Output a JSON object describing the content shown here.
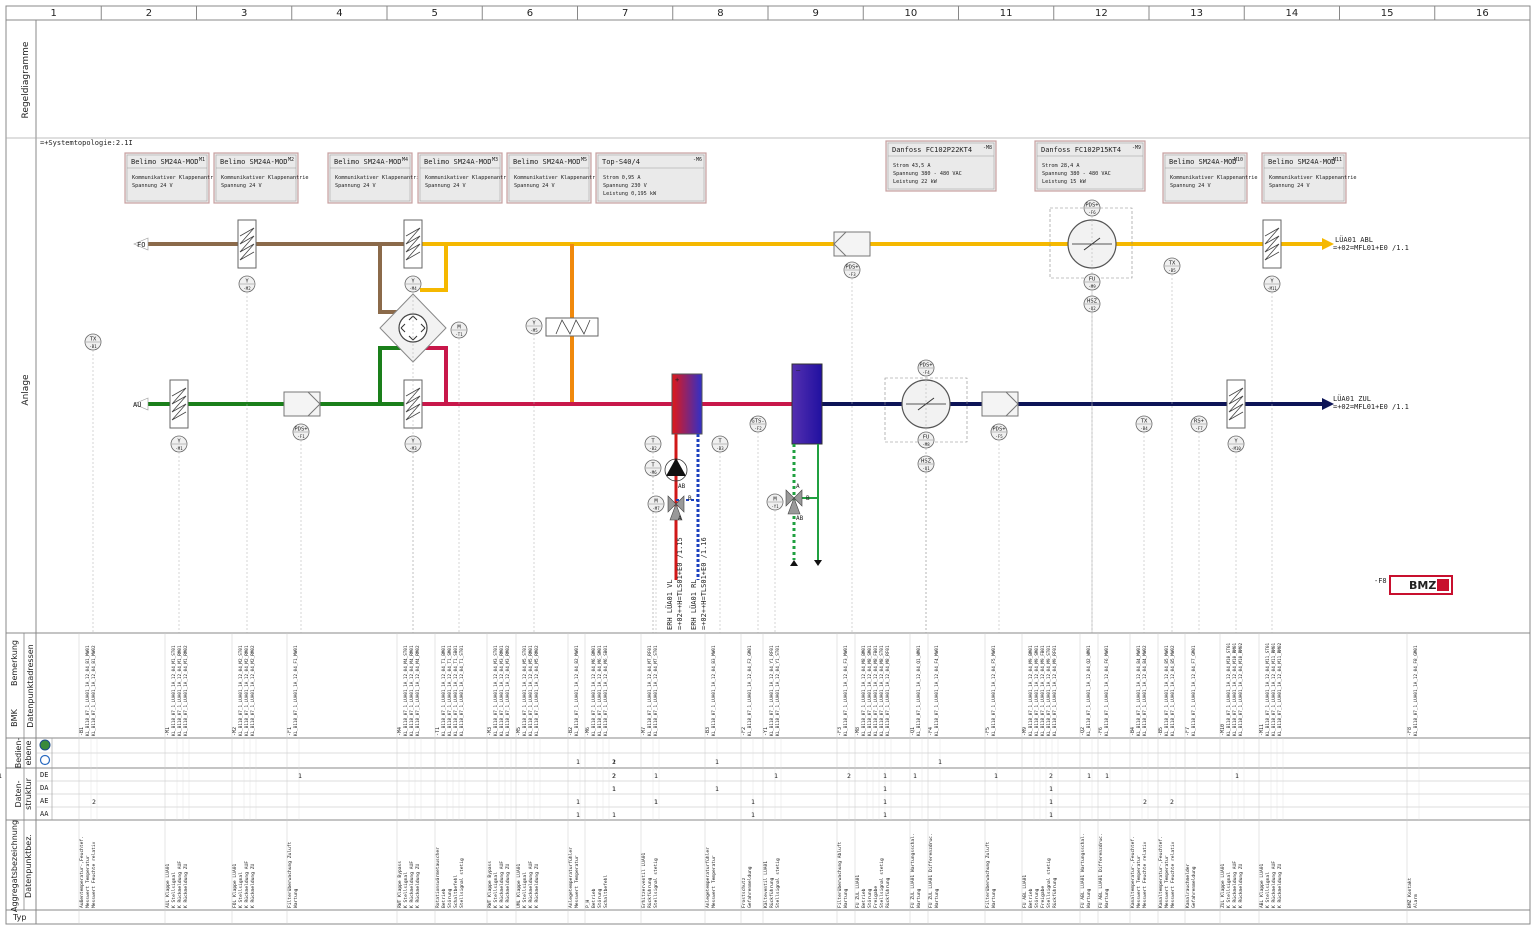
{
  "columns": [
    "1",
    "2",
    "3",
    "4",
    "5",
    "6",
    "7",
    "8",
    "9",
    "10",
    "11",
    "12",
    "13",
    "14",
    "15",
    "16"
  ],
  "row_labels": {
    "regel": "Regeldiagramme",
    "anlage": "Anlage",
    "bmk_a": "BMK",
    "bmk_b": "Datenpunktadressen",
    "bem_a": "Bemerkung",
    "bed_a": "Bedien-",
    "bed_b": "ebene",
    "dat_a": "Daten-",
    "dat_b": "struktur",
    "agg_a": "Aggregatsbezeichnung",
    "agg_b": "Datenpunktbez.",
    "typ": "Typ",
    "de": "DE",
    "da": "DA",
    "ae": "AE",
    "aa": "AA"
  },
  "topology": "=+Systemtopologie:2.1I",
  "devices": [
    {
      "name": "Belimo SM24A-MOD",
      "tag": "-M1",
      "line1": "Kommunikativer Klappenantrie",
      "line2": "Spannung    24 V"
    },
    {
      "name": "Belimo SM24A-MOD",
      "tag": "-M2",
      "line1": "Kommunikativer Klappenantrie",
      "line2": "Spannung    24 V"
    },
    {
      "name": "Belimo SM24A-MOD",
      "tag": "-M4",
      "line1": "Kommunikativer Klappenantrie",
      "line2": "Spannung    24 V"
    },
    {
      "name": "Belimo SM24A-MOD",
      "tag": "-M3",
      "line1": "Kommunikativer Klappenantrie",
      "line2": "Spannung    24 V"
    },
    {
      "name": "Belimo SM24A-MOD",
      "tag": "-M5",
      "line1": "Kommunikativer Klappenantrie",
      "line2": "Spannung    24 V"
    },
    {
      "name": "Top-S40/4",
      "tag": "-M6",
      "line1": "Strom    0,95 A",
      "line2": "Spannung  230 V",
      "line3": "Leistung  0,195 kW"
    },
    {
      "name": "Danfoss FC102P22KT4",
      "tag": "-M8",
      "line1": "Strom    43,5 A",
      "line2": "Spannung  380 - 480 VAC",
      "line3": "Leistung  22 kW"
    },
    {
      "name": "Danfoss FC102P15KT4",
      "tag": "-M9",
      "line1": "Strom    28,4 A",
      "line2": "Spannung  380 - 480 VAC",
      "line3": "Leistung  15 kW"
    },
    {
      "name": "Belimo SM24A-MOD",
      "tag": "-M10",
      "line1": "Kommunikativer Klappenantrie",
      "line2": "Spannung    24 V"
    },
    {
      "name": "Belimo SM24A-MOD",
      "tag": "-M11",
      "line1": "Kommunikativer Klappenantrie",
      "line2": "Spannung    24 V"
    }
  ],
  "labels": {
    "fo": "FO",
    "au": "AU",
    "abl": "LÜA01 ABL",
    "abl_ref": "=+02=MFL01+E0 /1.1",
    "zul": "LÜA01 ZUL",
    "zul_ref": "=+02=MFL01+E0 /1.1",
    "vl": "ERH LÜA01 VL",
    "vl_ref": "=+02++H=TLS01+E0 /1.15",
    "rl": "ERH LÜA01 RL",
    "rl_ref": "=+02++H=TLS01+E0 /1.16",
    "bmz": "BMZ",
    "bmz_tag": "-F8"
  },
  "sensors": {
    "y": "Y",
    "m": "M",
    "tx": "TX",
    "t": "T",
    "pds": "PDS+",
    "fu": "FU",
    "hsz": "HSZ",
    "rs": "RS+",
    "gts": "GTS-",
    "m1": "-M1",
    "m2": "-M2",
    "m3": "-M3",
    "m4": "-M4",
    "m5": "-M5",
    "m7": "-M7",
    "m9": "-M9",
    "m10": "-M10",
    "m11": "-M11",
    "b1": "-B1",
    "b2": "-B2",
    "b3": "-B3",
    "b4": "-B4",
    "b5": "-B5",
    "f1": "-F1",
    "f2": "-F2",
    "f3": "-F3",
    "f4": "-F4",
    "f5": "-F5",
    "f6": "-F6",
    "f7": "-F7",
    "t1": "-T1",
    "q1": "-Q1",
    "q2": "-Q2",
    "m6": "-M6",
    "m8": "-M8",
    "y1": "-Y1",
    "a": "A",
    "b": "B",
    "ab": "AB"
  },
  "datapoints": [
    {
      "bmk": "-B1",
      "addrs": [
        "KL_B118_07_1_LUA01_1A_12_04_B1_MW01",
        "KL_B118_07_1_LUA01_1A_12_04_B1_MW02"
      ],
      "agg": "Außentemperatur-,Feuchtef.",
      "items": [
        "Messwert Temperatur",
        "Messwert Feuchte relativ"
      ]
    },
    {
      "bmk": "-M1",
      "addrs": [
        "KL_B118_07_1_LUA01_1A_12_04_M1_ST01",
        "KL_B118_07_1_LUA01_1A_12_04_M1_RM01",
        "KL_B118_07_1_LUA01_1A_12_04_M1_RM02"
      ],
      "agg": "AUL Klappe LUA01",
      "items": [
        "K Stellsignal",
        "K Rückmeldung AUF",
        "K Rückmeldung ZU"
      ]
    },
    {
      "bmk": "-M2",
      "addrs": [
        "KL_B118_07_1_LUA01_1A_12_04_M2_ST01",
        "KL_B118_07_1_LUA01_1A_12_04_M2_RM01",
        "KL_B118_07_1_LUA01_1A_12_04_M2_RM02"
      ],
      "agg": "FOL Klappe LUA01",
      "items": [
        "K Stellsignal",
        "K Rückmeldung AUF",
        "K Rückmeldung ZU"
      ]
    },
    {
      "bmk": "-F1",
      "addrs": [
        "KL_B118_07_1_LUA01_1A_12_04_F1_MW01"
      ],
      "agg": "Filterüberwachung Zuluft",
      "items": [
        "Wartung"
      ]
    },
    {
      "bmk": "-M4",
      "addrs": [
        "KL_B118_07_1_LUA01_1A_12_04_M4_ST01",
        "KL_B118_07_1_LUA01_1A_12_04_M4_RM01",
        "KL_B118_07_1_LUA01_1A_12_04_M4_RM02"
      ],
      "agg": "RWT Klappe Bypass",
      "items": [
        "K Stellsignal",
        "K Rückmeldung AUF",
        "K Rückmeldung ZU"
      ]
    },
    {
      "bmk": "-T1",
      "addrs": [
        "KL_B118_07_1_LUA01_1A_12_04_T1_BM01",
        "KL_B118_07_1_LUA01_1A_12_04_T1_SM01",
        "KL_B118_07_1_LUA01_1A_12_04_T1_SB01",
        "KL_B118_07_1_LUA01_1A_12_04_T1_ST01"
      ],
      "agg": "Rotationswärmetauscher",
      "items": [
        "Betrieb",
        "Störung",
        "Schaltbefehl",
        "Stellsignal stetig"
      ]
    },
    {
      "bmk": "-M3",
      "addrs": [
        "KL_B118_07_1_LUA01_1A_12_04_M3_ST01",
        "KL_B118_07_1_LUA01_1A_12_04_M3_RM01",
        "KL_B118_07_1_LUA01_1A_12_04_M3_RM02"
      ],
      "agg": "RWT Klappe Bypass",
      "items": [
        "K Stellsignal",
        "K Rückmeldung AUF",
        "K Rückmeldung ZU"
      ]
    },
    {
      "bmk": "-M5",
      "addrs": [
        "KL_B118_07_1_LUA01_1A_12_04_M5_ST01",
        "KL_B118_07_1_LUA01_1A_12_04_M5_RM01",
        "KL_B118_07_1_LUA01_1A_12_04_M5_RM02"
      ],
      "agg": "UML Klappe LUA01",
      "items": [
        "K Stellsignal",
        "K Rückmeldung AUF",
        "K Rückmeldung ZU"
      ]
    },
    {
      "bmk": "-B2",
      "addrs": [
        "KL_B118_07_1_LUA01_1A_12_04_B2_MW01"
      ],
      "agg": "Anlegetemperaturfühler",
      "items": [
        "Messwert Temperatur"
      ]
    },
    {
      "bmk": "-M6",
      "addrs": [
        "KL_B118_07_1_LUA01_1A_12_04_M6_BM01",
        "KL_B118_07_1_LUA01_1A_12_04_M6_SM01",
        "KL_B118_07_1_LUA01_1A_12_04_M6_SB01"
      ],
      "agg": "P_H",
      "items": [
        "Betrieb",
        "Störung",
        "Schaltbefehl"
      ]
    },
    {
      "bmk": "-M7",
      "addrs": [
        "KL_B118_07_1_LUA01_1A_12_04_M7_RF01",
        "KL_B118_07_1_LUA01_1A_12_04_M7_ST01"
      ],
      "agg": "Erhitzerventil LUA01",
      "items": [
        "Rückführung",
        "Stellsignal stetig"
      ]
    },
    {
      "bmk": "-B3",
      "addrs": [
        "KL_B118_07_1_LUA01_1A_12_04_B3_MW01"
      ],
      "agg": "Anlegetemperaturfühler",
      "items": [
        "Messwert Temperatur"
      ]
    },
    {
      "bmk": "-F2",
      "addrs": [
        "KL_B118_07_1_LUA01_1A_12_04_F2_GM01"
      ],
      "agg": "Frostschutz",
      "items": [
        "Gefahrenmeldung"
      ]
    },
    {
      "bmk": "-Y1",
      "addrs": [
        "KL_B118_07_1_LUA01_1A_12_04_Y1_RF01",
        "KL_B118_07_1_LUA01_1A_12_04_Y1_ST01"
      ],
      "agg": "Kälteventil LUA01",
      "items": [
        "Rückführung",
        "Stellsignal stetig"
      ]
    },
    {
      "bmk": "-F3",
      "addrs": [
        "KL_B118_07_1_LUA01_1A_12_04_F3_MW01"
      ],
      "agg": "Filterüberwachung Abluft",
      "items": [
        "Wartung"
      ]
    },
    {
      "bmk": "-M8",
      "addrs": [
        "KL_B118_07_1_LUA01_1A_12_04_M8_BM01",
        "KL_B118_07_1_LUA01_1A_12_04_M8_SM01",
        "KL_B118_07_1_LUA01_1A_12_04_M8_FB01",
        "KL_B118_07_1_LUA01_1A_12_04_M8_ST01",
        "KL_B118_07_1_LUA01_1A_12_04_M8_RF01"
      ],
      "agg": "FU ZUL LUA01",
      "items": [
        "Betrieb",
        "Störung",
        "Freigabe",
        "Stellsignal stetig",
        "Rückführung"
      ]
    },
    {
      "bmk": "-Q1",
      "addrs": [
        "KL_B118_07_1_LUA01_1A_12_04_Q1_WM01"
      ],
      "agg": "FU ZUL LUA01 Wartungsschal.",
      "items": [
        "Wartung"
      ]
    },
    {
      "bmk": "-F4",
      "addrs": [
        "KL_B118_07_1_LUA01_1A_12_04_F4_MW01"
      ],
      "agg": "FU ZUL LUA01 Differenzdruc.",
      "items": [
        "Wartung"
      ]
    },
    {
      "bmk": "-F5",
      "addrs": [
        "KL_B118_07_1_LUA01_1A_12_04_F5_MW01"
      ],
      "agg": "Filterüberwachung Zuluft",
      "items": [
        "Wartung"
      ]
    },
    {
      "bmk": "-M9",
      "addrs": [
        "KL_B118_07_1_LUA01_1A_12_04_M9_BM01",
        "KL_B118_07_1_LUA01_1A_12_04_M9_SM01",
        "KL_B118_07_1_LUA01_1A_12_04_M9_FB01",
        "KL_B118_07_1_LUA01_1A_12_04_M9_ST01",
        "KL_B118_07_1_LUA01_1A_12_04_M9_RF01"
      ],
      "agg": "FU ABL LUA01",
      "items": [
        "Betrieb",
        "Störung",
        "Freigabe",
        "Stellsignal stetig",
        "Rückführung"
      ]
    },
    {
      "bmk": "-Q2",
      "addrs": [
        "KL_B118_07_1_LUA01_1A_12_04_Q2_WM01"
      ],
      "agg": "FU ABL LUA01 Wartungsschal.",
      "items": [
        "Wartung"
      ]
    },
    {
      "bmk": "-F6",
      "addrs": [
        "KL_B118_07_1_LUA01_1A_12_04_F6_MW01"
      ],
      "agg": "FU ABL LUA01 Differenzdruc.",
      "items": [
        "Wartung"
      ]
    },
    {
      "bmk": "-B4",
      "addrs": [
        "KL_B118_07_1_LUA01_1A_12_04_B4_MW01",
        "KL_B118_07_1_LUA01_1A_12_04_B4_MW02"
      ],
      "agg": "Kanaltemperatur-,Feuchtef.",
      "items": [
        "Messwert Temperatur",
        "Messwert Feuchte relativ"
      ]
    },
    {
      "bmk": "-B5",
      "addrs": [
        "KL_B118_07_1_LUA01_1A_12_04_B5_MW01",
        "KL_B118_07_1_LUA01_1A_12_04_B5_MW02"
      ],
      "agg": "Kanaltemperatur-,Feuchtef.",
      "items": [
        "Messwert Temperatur",
        "Messwert Feuchte relativ"
      ]
    },
    {
      "bmk": "-F7",
      "addrs": [
        "KL_B118_07_1_LUA01_1A_12_04_F7_GM01"
      ],
      "agg": "Kanalrauchmelder",
      "items": [
        "Gefahrenmeldung"
      ]
    },
    {
      "bmk": "-M10",
      "addrs": [
        "KL_B118_07_1_LUA01_1A_12_04_M10_ST01",
        "KL_B118_07_1_LUA01_1A_12_04_M10_RM01",
        "KL_B118_07_1_LUA01_1A_12_04_M10_RM02"
      ],
      "agg": "ZUL Klappe LUA01",
      "items": [
        "K Stellsignal",
        "K Rückmeldung AUF",
        "K Rückmeldung ZU"
      ]
    },
    {
      "bmk": "-M11",
      "addrs": [
        "KL_B118_07_1_LUA01_1A_12_04_M11_ST01",
        "KL_B118_07_1_LUA01_1A_12_04_M11_RM01",
        "KL_B118_07_1_LUA01_1A_12_04_M11_RM02"
      ],
      "agg": "ABL Klappe LUA01",
      "items": [
        "K Stellsignal",
        "K Rückmeldung AUF",
        "K Rückmeldung ZU"
      ]
    },
    {
      "bmk": "-F8",
      "addrs": [
        "KL_B118_07_1_LUA01_1A_12_04_F8_GM01"
      ],
      "agg": "BMZ Kontakt",
      "items": [
        "Alarm"
      ]
    }
  ],
  "counts": {
    "bed1": [
      {
        "c": "6",
        "v": "2"
      },
      {
        "c": "8",
        "v": "1"
      },
      {
        "c": "9",
        "v": "1"
      },
      {
        "c": "11",
        "v": "1"
      },
      {
        "c": "17",
        "v": "1"
      }
    ],
    "de": [
      {
        "c": "3",
        "v": "1"
      },
      {
        "c": "6",
        "v": "2"
      },
      {
        "c": "8",
        "v": "2"
      },
      {
        "c": "10",
        "v": "1"
      },
      {
        "c": "13",
        "v": "1"
      },
      {
        "c": "14",
        "v": "2"
      },
      {
        "c": "15",
        "v": "1"
      },
      {
        "c": "16",
        "v": "1"
      },
      {
        "c": "18",
        "v": "1"
      },
      {
        "c": "19",
        "v": "2"
      },
      {
        "c": "20",
        "v": "1"
      },
      {
        "c": "21",
        "v": "1"
      },
      {
        "c": "25",
        "v": "1"
      },
      {
        "c": "28",
        "v": "1"
      }
    ],
    "da": [
      {
        "c": "6",
        "v": "1"
      },
      {
        "c": "8",
        "v": "1"
      },
      {
        "c": "11",
        "v": "1"
      },
      {
        "c": "15",
        "v": "1"
      },
      {
        "c": "19",
        "v": "1"
      }
    ],
    "ae": [
      {
        "c": "0",
        "v": "2"
      },
      {
        "c": "7",
        "v": "1"
      },
      {
        "c": "9",
        "v": "1"
      },
      {
        "c": "10",
        "v": "1"
      },
      {
        "c": "12",
        "v": "1"
      },
      {
        "c": "15",
        "v": "1"
      },
      {
        "c": "19",
        "v": "1"
      },
      {
        "c": "22",
        "v": "2"
      },
      {
        "c": "23",
        "v": "2"
      }
    ],
    "aa": [
      {
        "c": "6",
        "v": "1"
      },
      {
        "c": "9",
        "v": "1"
      },
      {
        "c": "12",
        "v": "1"
      },
      {
        "c": "15",
        "v": "1"
      },
      {
        "c": "19",
        "v": "1"
      }
    ]
  },
  "colors": {
    "fo": "#8b6a4a",
    "abl": "#f5b800",
    "au": "#1a7f1a",
    "zul": "#c8174a",
    "zul_cold": "#0d1457",
    "orange": "#f0890c",
    "vl": "#d01818",
    "rl": "#1a3fbf",
    "kvl": "#20a040",
    "bmz": "#c8102e"
  }
}
